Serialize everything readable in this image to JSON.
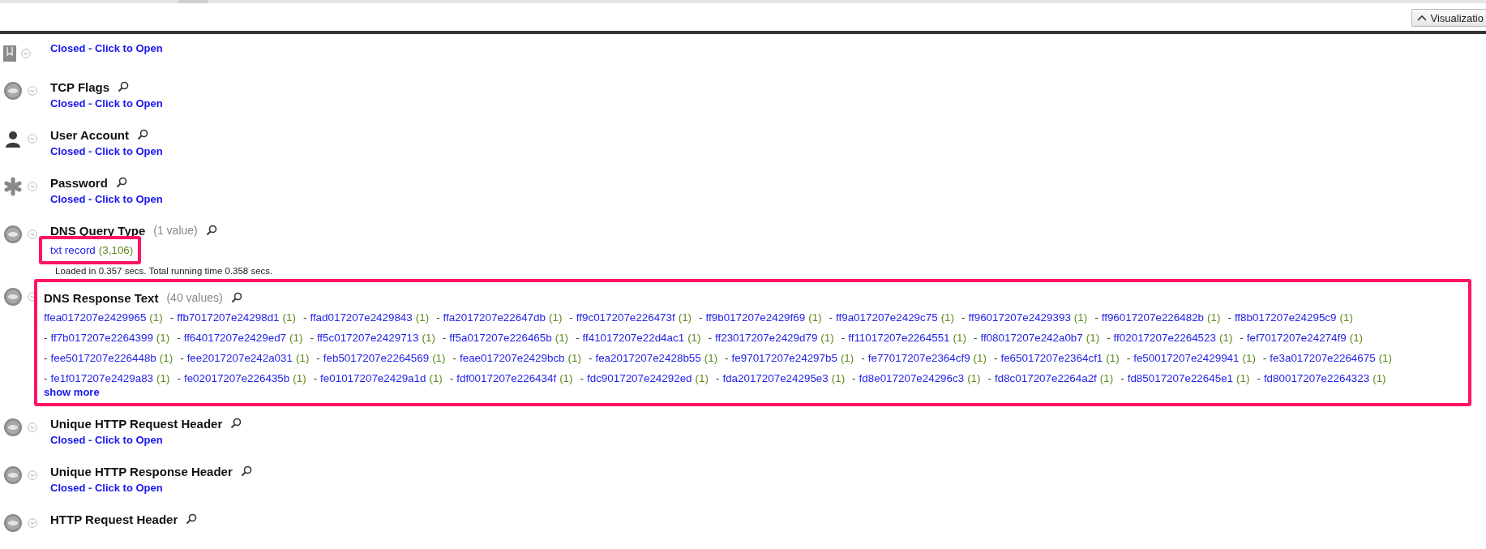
{
  "toolbar": {
    "button": "Visualizatio"
  },
  "sections": [
    {
      "kind": "bookmark",
      "status": "Closed - Click to Open"
    },
    {
      "kind": "badge",
      "title": "TCP Flags",
      "status": "Closed - Click to Open"
    },
    {
      "kind": "person",
      "title": "User Account",
      "status": "Closed - Click to Open"
    },
    {
      "kind": "asterisk",
      "title": "Password",
      "status": "Closed - Click to Open"
    },
    {
      "kind": "badge",
      "title": "DNS Query Type",
      "count": "(1 value)",
      "rows": [
        [
          {
            "value": "txt record",
            "count": "(3,106)",
            "highlighted": true
          }
        ]
      ],
      "timing": "Loaded in 0.357 secs. Total running time 0.358 secs."
    },
    {
      "kind": "badge",
      "title": "DNS Response Text",
      "count": "(40 values)",
      "highlighted": true,
      "rows": [
        [
          {
            "value": "ffea017207e2429965",
            "count": "(1)"
          },
          {
            "dash": "-",
            "value": "ffb7017207e24298d1",
            "count": "(1)"
          },
          {
            "dash": "-",
            "value": "ffad017207e2429843",
            "count": "(1)"
          },
          {
            "dash": "-",
            "value": "ffa2017207e22647db",
            "count": "(1)"
          },
          {
            "dash": "-",
            "value": "ff9c017207e226473f",
            "count": "(1)"
          },
          {
            "dash": "-",
            "value": "ff9b017207e2429f69",
            "count": "(1)"
          },
          {
            "dash": "-",
            "value": "ff9a017207e2429c75",
            "count": "(1)"
          },
          {
            "dash": "-",
            "value": "ff96017207e2429393",
            "count": "(1)"
          },
          {
            "dash": "-",
            "value": "ff96017207e226482b",
            "count": "(1)"
          },
          {
            "dash": "-",
            "value": "ff8b017207e24295c9",
            "count": "(1)"
          }
        ],
        [
          {
            "dash": "-",
            "value": "ff7b017207e2264399",
            "count": "(1)"
          },
          {
            "dash": "-",
            "value": "ff64017207e2429ed7",
            "count": "(1)"
          },
          {
            "dash": "-",
            "value": "ff5c017207e2429713",
            "count": "(1)"
          },
          {
            "dash": "-",
            "value": "ff5a017207e226465b",
            "count": "(1)"
          },
          {
            "dash": "-",
            "value": "ff41017207e22d4ac1",
            "count": "(1)"
          },
          {
            "dash": "-",
            "value": "ff23017207e2429d79",
            "count": "(1)"
          },
          {
            "dash": "-",
            "value": "ff11017207e2264551",
            "count": "(1)"
          },
          {
            "dash": "-",
            "value": "ff08017207e242a0b7",
            "count": "(1)"
          },
          {
            "dash": "-",
            "value": "ff02017207e2264523",
            "count": "(1)"
          },
          {
            "dash": "-",
            "value": "fef7017207e24274f9",
            "count": "(1)"
          }
        ],
        [
          {
            "dash": "-",
            "value": "fee5017207e226448b",
            "count": "(1)"
          },
          {
            "dash": "-",
            "value": "fee2017207e242a031",
            "count": "(1)"
          },
          {
            "dash": "-",
            "value": "feb5017207e2264569",
            "count": "(1)"
          },
          {
            "dash": "-",
            "value": "feae017207e2429bcb",
            "count": "(1)"
          },
          {
            "dash": "-",
            "value": "fea2017207e2428b55",
            "count": "(1)"
          },
          {
            "dash": "-",
            "value": "fe97017207e24297b5",
            "count": "(1)"
          },
          {
            "dash": "-",
            "value": "fe77017207e2364cf9",
            "count": "(1)"
          },
          {
            "dash": "-",
            "value": "fe65017207e2364cf1",
            "count": "(1)"
          },
          {
            "dash": "-",
            "value": "fe50017207e2429941",
            "count": "(1)"
          },
          {
            "dash": "-",
            "value": "fe3a017207e2264675",
            "count": "(1)"
          }
        ],
        [
          {
            "dash": "-",
            "value": "fe1f017207e2429a83",
            "count": "(1)"
          },
          {
            "dash": "-",
            "value": "fe02017207e226435b",
            "count": "(1)"
          },
          {
            "dash": "-",
            "value": "fe01017207e2429a1d",
            "count": "(1)"
          },
          {
            "dash": "-",
            "value": "fdf0017207e226434f",
            "count": "(1)"
          },
          {
            "dash": "-",
            "value": "fdc9017207e24292ed",
            "count": "(1)"
          },
          {
            "dash": "-",
            "value": "fda2017207e24295e3",
            "count": "(1)"
          },
          {
            "dash": "-",
            "value": "fd8e017207e24296c3",
            "count": "(1)"
          },
          {
            "dash": "-",
            "value": "fd8c017207e2264a2f",
            "count": "(1)"
          },
          {
            "dash": "-",
            "value": "fd85017207e22645e1",
            "count": "(1)"
          },
          {
            "dash": "-",
            "value": "fd80017207e2264323",
            "count": "(1)"
          }
        ]
      ],
      "more": "show more"
    },
    {
      "kind": "badge",
      "title": "Unique HTTP Request Header",
      "status": "Closed - Click to Open"
    },
    {
      "kind": "badge",
      "title": "Unique HTTP Response Header",
      "status": "Closed - Click to Open"
    },
    {
      "kind": "badge",
      "title": "HTTP Request Header"
    }
  ]
}
